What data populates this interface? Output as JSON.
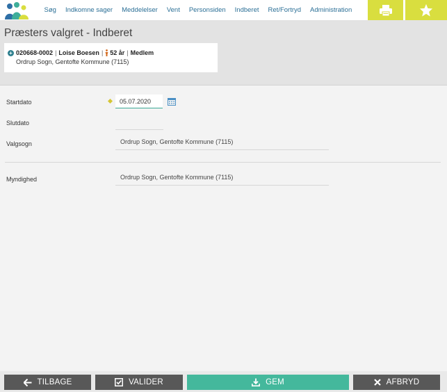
{
  "nav": {
    "items": [
      "Søg",
      "Indkomne sager",
      "Meddelelser",
      "Vent",
      "Personsiden",
      "Indberet",
      "Ret/Fortryd",
      "Administration"
    ]
  },
  "colors": {
    "accent_yellow": "#d9de3f",
    "primary_green": "#44b89c",
    "link_blue": "#2b6f96",
    "dark_button": "#585858"
  },
  "icons": {
    "logo": "people-logo",
    "print": "printer-icon",
    "favorite": "star-icon",
    "calendar": "calendar-icon",
    "back": "arrow-left-icon",
    "validate": "checkbox-icon",
    "save": "download-icon",
    "cancel": "close-icon",
    "person": "person-icon"
  },
  "page": {
    "title": "Præsters valgret - Indberet"
  },
  "person": {
    "cpr": "020668-0002",
    "name": "Loise Boesen",
    "age": "52 år",
    "status": "Medlem",
    "parish": "Ordrup Sogn, Gentofte Kommune (7115)"
  },
  "form": {
    "startdato_label": "Startdato",
    "startdato_value": "05.07.2020",
    "slutdato_label": "Slutdato",
    "valgsogn_label": "Valgsogn",
    "valgsogn_value": "Ordrup Sogn, Gentofte Kommune (7115)",
    "myndighed_label": "Myndighed",
    "myndighed_value": "Ordrup Sogn, Gentofte Kommune (7115)"
  },
  "buttons": {
    "back": "TILBAGE",
    "validate": "VALIDER",
    "save": "GEM",
    "cancel": "AFBRYD"
  }
}
